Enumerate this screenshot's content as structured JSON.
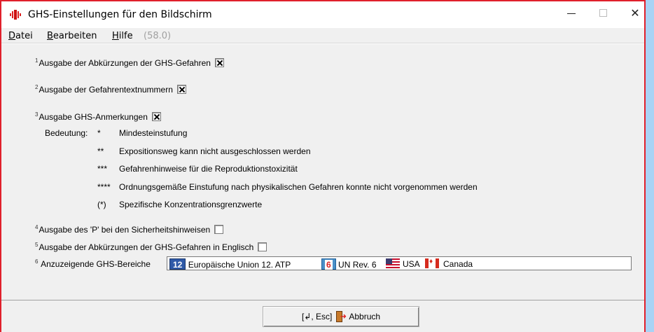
{
  "window": {
    "title": "GHS-Einstellungen für den Bildschirm",
    "controls": {
      "minimize": "—",
      "maximize": "☐",
      "close": "✕"
    }
  },
  "menu": {
    "datei": {
      "accel": "D",
      "rest": "atei"
    },
    "bearbeiten": {
      "accel": "B",
      "rest": "earbeiten"
    },
    "hilfe": {
      "accel": "H",
      "rest": "ilfe"
    },
    "version": "(58.0)"
  },
  "options": [
    {
      "num": "1",
      "label": "Ausgabe der Abkürzungen der GHS-Gefahren",
      "checked": true
    },
    {
      "num": "2",
      "label": "Ausgabe der Gefahrentextnummern",
      "checked": true
    },
    {
      "num": "3",
      "label": "Ausgabe GHS-Anmerkungen",
      "checked": true
    },
    {
      "num": "4",
      "label": "Ausgabe des 'P' bei den Sicherheitshinweisen",
      "checked": false
    },
    {
      "num": "5",
      "label": "Ausgabe der Abkürzungen der GHS-Gefahren in Englisch",
      "checked": false
    }
  ],
  "meaning": {
    "label": "Bedeutung:",
    "items": [
      {
        "sym": "*",
        "text": "Mindesteinstufung"
      },
      {
        "sym": "**",
        "text": "Expositionsweg kann nicht ausgeschlossen werden"
      },
      {
        "sym": "***",
        "text": "Gefahrenhinweise für die Reproduktionstoxizität"
      },
      {
        "sym": "****",
        "text": "Ordnungsgemäße Einstufung nach physikalischen Gefahren konnte nicht vorgenommen werden"
      },
      {
        "sym": "(*)",
        "text": "Spezifische Konzentrationsgrenzwerte"
      }
    ]
  },
  "areas": {
    "num": "6",
    "label": "Anzuzeigende GHS-Bereiche",
    "eu_badge": "12",
    "eu_text": "Europäische Union 12. ATP",
    "un_badge": "6",
    "un_text": "UN Rev. 6",
    "usa_text": "USA",
    "canada_text": "Canada"
  },
  "footer": {
    "cancel_keys": "[↲, Esc]",
    "cancel_label": "Abbruch"
  },
  "colors": {
    "window_border": "#e0202b",
    "dialog_bg": "#f0f0f0",
    "desktop": "#a9d3f5"
  }
}
